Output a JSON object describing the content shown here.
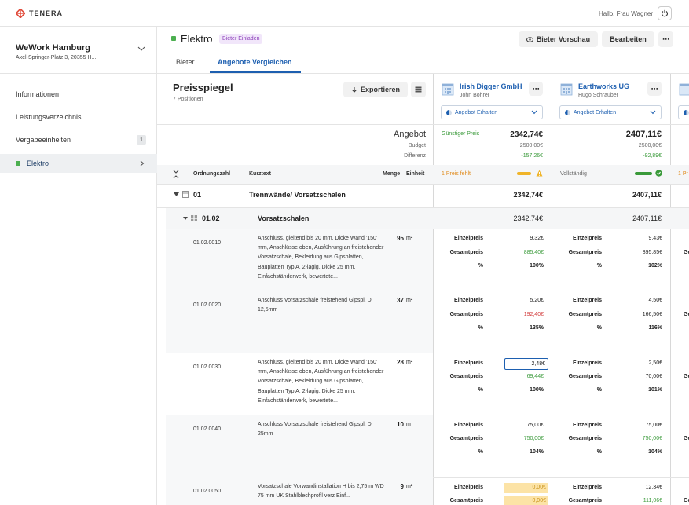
{
  "brand": {
    "name": "TENERA",
    "color": "#e04a3a"
  },
  "header": {
    "greeting": "Hallo, Frau Wagner",
    "power_icon": "power-icon"
  },
  "project": {
    "name": "WeWork Hamburg",
    "address": "Axel-Springer-Platz 3, 20355 H..."
  },
  "nav": {
    "items": [
      {
        "label": "Informationen"
      },
      {
        "label": "Leistungsverzeichnis"
      },
      {
        "label": "Vergabeeinheiten",
        "badge": "1"
      },
      {
        "label": "Elektro",
        "active": true
      }
    ]
  },
  "unit": {
    "title": "Elektro",
    "invite_badge": "Bieter Einladen",
    "preview_button": "Bieter Vorschau",
    "edit_button": "Bearbeiten"
  },
  "tabs": [
    {
      "label": "Bieter"
    },
    {
      "label": "Angebote Vergleichen",
      "active": true
    }
  ],
  "preisspiegel": {
    "title": "Preisspiegel",
    "subtitle": "7 Positionen",
    "export_button": "Exportieren"
  },
  "summary_labels": {
    "angebot": "Angebot",
    "budget": "Budget",
    "differenz": "Differenz"
  },
  "columns": {
    "ordnungszahl": "Ordnungszahl",
    "kurztext": "Kurztext",
    "menge": "Menge",
    "einheit": "Einheit"
  },
  "bidders": [
    {
      "name": "Irish Digger GmbH",
      "contact": "John Bohrer",
      "status": "Angebot Erhalten",
      "tag": "Günstiger Preis",
      "angebot": "2342,74€",
      "budget": "2500,00€",
      "differenz": "-157,26€",
      "completeness": "1 Preis fehlt",
      "group_total": "2342,74€",
      "sub_total": "2342,74€",
      "items": [
        {
          "einzelpreis": "9,32€",
          "gesamtpreis": "885,40€",
          "prozent": "100%"
        },
        {
          "einzelpreis": "5,20€",
          "gesamtpreis": "192,40€",
          "prozent": "135%"
        },
        {
          "einzelpreis": "2,48€",
          "gesamtpreis": "69,44€",
          "prozent": "100%"
        },
        {
          "einzelpreis": "75,00€",
          "gesamtpreis": "750,00€",
          "prozent": "104%"
        },
        {
          "einzelpreis": "0,00€",
          "gesamtpreis": "0,00€"
        }
      ]
    },
    {
      "name": "Earthworks UG",
      "contact": "Hugo Schrauber",
      "status": "Angebot Erhalten",
      "angebot": "2407,11€",
      "budget": "2500,00€",
      "differenz": "-92,89€",
      "completeness": "Vollständig",
      "group_total": "2407,11€",
      "sub_total": "2407,11€",
      "items": [
        {
          "einzelpreis": "9,43€",
          "gesamtpreis": "895,85€",
          "prozent": "102%"
        },
        {
          "einzelpreis": "4,50€",
          "gesamtpreis": "166,50€",
          "prozent": "116%"
        },
        {
          "einzelpreis": "2,50€",
          "gesamtpreis": "70,00€",
          "prozent": "101%"
        },
        {
          "einzelpreis": "75,00€",
          "gesamtpreis": "750,00€",
          "prozent": "104%"
        },
        {
          "einzelpreis": "12,34€",
          "gesamtpreis": "111,06€"
        }
      ]
    }
  ],
  "price_labels": {
    "einzelpreis": "Einzelpreis",
    "gesamtpreis": "Gesamtpreis",
    "prozent": "%"
  },
  "third_column_partial": {
    "completeness": "1 Pr",
    "label": "Ge"
  },
  "group": {
    "oz": "01",
    "text": "Trennwände/ Vorsatzschalen"
  },
  "subgroup": {
    "oz": "01.02",
    "text": "Vorsatzschalen"
  },
  "positions": [
    {
      "oz": "01.02.0010",
      "text": "Anschluss, gleitend bis 20 mm, Dicke Wand '150' mm, Anschlüsse oben, Ausführung an freistehender Vorsatzschale, Bekleidung aus Gipsplatten, Bauplatten Typ A, 2-lagig, Dicke 25 mm, Einfachständerwerk, bewertete...",
      "menge": "95",
      "einheit": "m²"
    },
    {
      "oz": "01.02.0020",
      "text": "Anschluss Vorsatzschale freistehend Gipspl. D 12,5mm",
      "menge": "37",
      "einheit": "m²"
    },
    {
      "oz": "01.02.0030",
      "text": "Anschluss, gleitend bis 20 mm, Dicke Wand '150' mm, Anschlüsse oben, Ausführung an freistehender Vorsatzschale, Bekleidung aus Gipsplatten, Bauplatten Typ A, 2-lagig, Dicke 25 mm, Einfachständerwerk, bewertete...",
      "menge": "28",
      "einheit": "m²"
    },
    {
      "oz": "01.02.0040",
      "text": "Anschluss Vorsatzschale freistehend Gipspl. D 25mm",
      "menge": "10",
      "einheit": "m"
    },
    {
      "oz": "01.02.0050",
      "text": "Vorsatzschale Vorwandinstallation H bis 2,75 m WD 75 mm UK Stahlblechprofil verz Einf...",
      "menge": "9",
      "einheit": "m²"
    }
  ],
  "colors": {
    "accent": "#1d5fb0",
    "success": "#3a9a3a",
    "danger": "#d23a3a",
    "warning": "#f0b429",
    "active_green": "#4caf50"
  }
}
